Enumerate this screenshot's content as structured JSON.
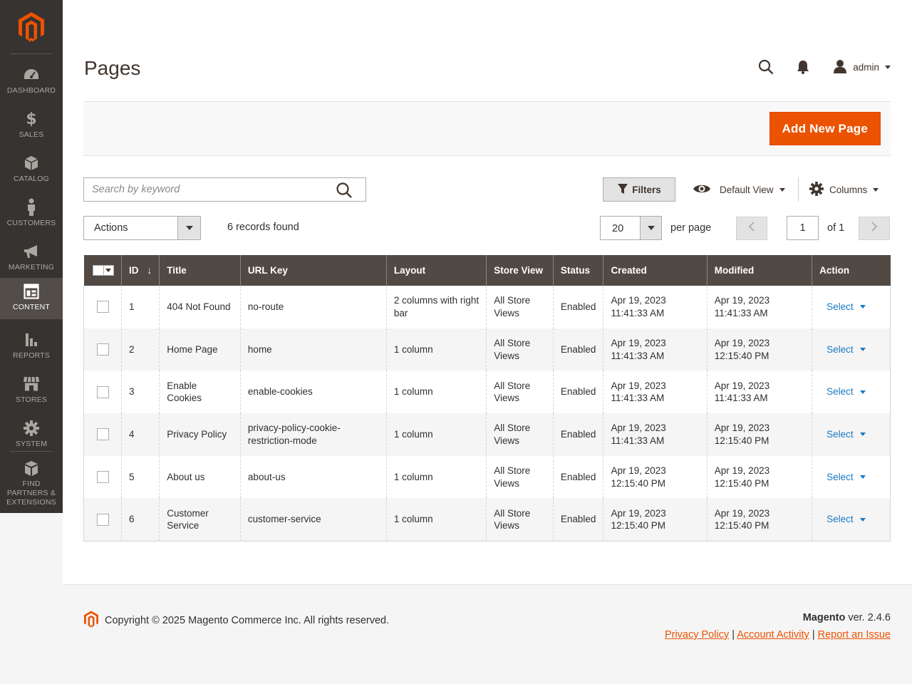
{
  "sidebar": {
    "logo": "magento-logo",
    "items": [
      {
        "label": "DASHBOARD",
        "icon": "dashboard-icon"
      },
      {
        "label": "SALES",
        "icon": "dollar-icon"
      },
      {
        "label": "CATALOG",
        "icon": "box-icon"
      },
      {
        "label": "CUSTOMERS",
        "icon": "person-icon"
      },
      {
        "label": "MARKETING",
        "icon": "megaphone-icon"
      },
      {
        "label": "CONTENT",
        "icon": "layout-icon",
        "active": true
      },
      {
        "label": "REPORTS",
        "icon": "bar-chart-icon"
      },
      {
        "label": "STORES",
        "icon": "store-icon"
      },
      {
        "label": "SYSTEM",
        "icon": "gear-icon"
      },
      {
        "label": "FIND PARTNERS & EXTENSIONS",
        "icon": "cubes-icon"
      }
    ]
  },
  "header": {
    "title": "Pages",
    "user": "admin"
  },
  "action_bar": {
    "add_button": "Add New Page"
  },
  "toolbar": {
    "search_placeholder": "Search by keyword",
    "filters": "Filters",
    "view": "Default View",
    "columns": "Columns",
    "actions": "Actions",
    "records": "6 records found",
    "per_page_value": "20",
    "per_page_label": "per page",
    "page_value": "1",
    "page_of": "of 1"
  },
  "table": {
    "columns": [
      "ID",
      "Title",
      "URL Key",
      "Layout",
      "Store View",
      "Status",
      "Created",
      "Modified",
      "Action"
    ],
    "rows": [
      {
        "id": "1",
        "title": "404 Not Found",
        "url_key": "no-route",
        "layout": "2 columns with right bar",
        "store_view": "All Store Views",
        "status": "Enabled",
        "created": "Apr 19, 2023 11:41:33 AM",
        "modified": "Apr 19, 2023 11:41:33 AM",
        "action": "Select"
      },
      {
        "id": "2",
        "title": "Home Page",
        "url_key": "home",
        "layout": "1 column",
        "store_view": "All Store Views",
        "status": "Enabled",
        "created": "Apr 19, 2023 11:41:33 AM",
        "modified": "Apr 19, 2023 12:15:40 PM",
        "action": "Select"
      },
      {
        "id": "3",
        "title": "Enable Cookies",
        "url_key": "enable-cookies",
        "layout": "1 column",
        "store_view": "All Store Views",
        "status": "Enabled",
        "created": "Apr 19, 2023 11:41:33 AM",
        "modified": "Apr 19, 2023 11:41:33 AM",
        "action": "Select"
      },
      {
        "id": "4",
        "title": "Privacy Policy",
        "url_key": "privacy-policy-cookie-restriction-mode",
        "layout": "1 column",
        "store_view": "All Store Views",
        "status": "Enabled",
        "created": "Apr 19, 2023 11:41:33 AM",
        "modified": "Apr 19, 2023 12:15:40 PM",
        "action": "Select"
      },
      {
        "id": "5",
        "title": "About us",
        "url_key": "about-us",
        "layout": "1 column",
        "store_view": "All Store Views",
        "status": "Enabled",
        "created": "Apr 19, 2023 12:15:40 PM",
        "modified": "Apr 19, 2023 12:15:40 PM",
        "action": "Select"
      },
      {
        "id": "6",
        "title": "Customer Service",
        "url_key": "customer-service",
        "layout": "1 column",
        "store_view": "All Store Views",
        "status": "Enabled",
        "created": "Apr 19, 2023 12:15:40 PM",
        "modified": "Apr 19, 2023 12:15:40 PM",
        "action": "Select"
      }
    ]
  },
  "footer": {
    "copyright": "Copyright © 2025 Magento Commerce Inc. All rights reserved.",
    "brand": "Magento",
    "version": " ver. 2.4.6",
    "links": [
      "Privacy Policy",
      "Account Activity",
      "Report an Issue"
    ]
  },
  "colors": {
    "accent": "#eb5202",
    "sidebar": "#373330",
    "table_header": "#514943",
    "link": "#1979c3"
  }
}
